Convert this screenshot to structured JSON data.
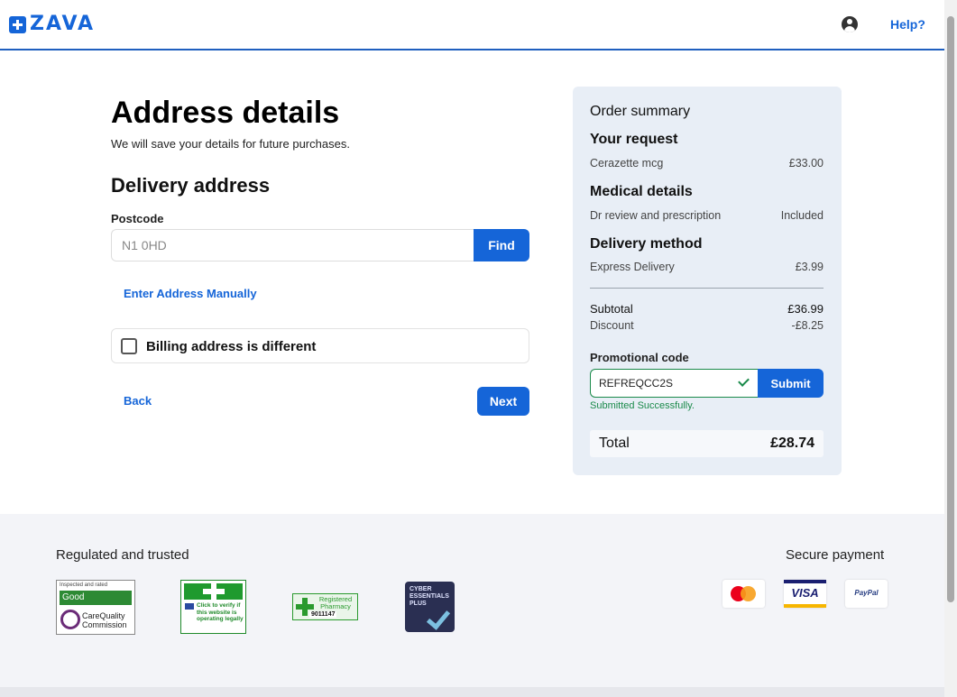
{
  "header": {
    "logo_text": "ZAVA",
    "help_label": "Help?"
  },
  "form": {
    "title": "Address details",
    "subtitle": "We will save your details for future purchases.",
    "section_title": "Delivery address",
    "postcode_label": "Postcode",
    "postcode_placeholder": "N1 0HD",
    "find_label": "Find",
    "manual_link": "Enter Address Manually",
    "billing_label": "Billing address is different",
    "back_label": "Back",
    "next_label": "Next"
  },
  "summary": {
    "title": "Order summary",
    "request_heading": "Your request",
    "request_item": "Cerazette mcg",
    "request_price": "£33.00",
    "medical_heading": "Medical details",
    "medical_item": "Dr review and prescription",
    "medical_price": "Included",
    "delivery_heading": "Delivery method",
    "delivery_item": "Express Delivery",
    "delivery_price": "£3.99",
    "subtotal_label": "Subtotal",
    "subtotal_value": "£36.99",
    "discount_label": "Discount",
    "discount_value": "-£8.25",
    "promo_label": "Promotional code",
    "promo_value": "REFREQCC2S",
    "submit_label": "Submit",
    "promo_status": "Submitted Successfully.",
    "total_label": "Total",
    "total_value": "£28.74"
  },
  "footer": {
    "regulated_title": "Regulated and trusted",
    "secure_title": "Secure payment",
    "cqc": {
      "small_text": "Inspected and rated",
      "rating": "Good",
      "name_line1": "CareQuality",
      "name_line2": "Commission"
    },
    "gphc_text": "Click to verify if this website is operating legally",
    "pharmacy_text": "Registered Pharmacy",
    "pharmacy_number": "9011147",
    "cyber_text": "CYBER ESSENTIALS PLUS",
    "payments": [
      "mastercard-logo",
      "visa-logo",
      "paypal-logo"
    ],
    "visa_text": "VISA",
    "paypal_text": "PayPal"
  },
  "colors": {
    "brand_blue": "#1565d8",
    "success_green": "#1a8a4a",
    "summary_bg": "#e8eef6",
    "footer_bg": "#f3f4f8"
  }
}
